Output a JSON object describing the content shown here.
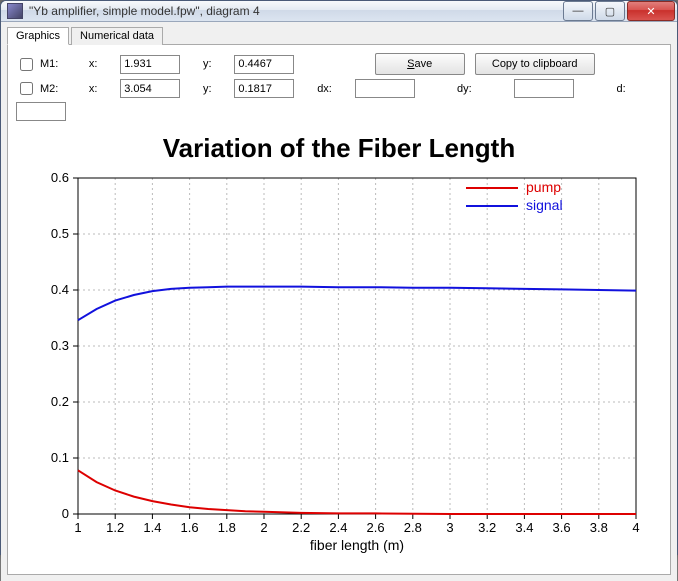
{
  "window": {
    "title": "\"Yb amplifier, simple model.fpw\", diagram 4",
    "controls": {
      "min": "—",
      "max": "▢",
      "close": "✕"
    }
  },
  "tabs": {
    "graphics": "Graphics",
    "numerical": "Numerical data"
  },
  "controls": {
    "m1_label": "M1:",
    "m2_label": "M2:",
    "x_label": "x:",
    "y_label": "y:",
    "dx_label": "dx:",
    "dy_label": "dy:",
    "d_label": "d:",
    "m1": {
      "x": "1.931",
      "y": "0.4467"
    },
    "m2": {
      "x": "3.054",
      "y": "0.1817"
    },
    "dx": "",
    "dy": "",
    "d": "",
    "save": "Save",
    "copy": "Copy to clipboard"
  },
  "chart_data": {
    "type": "line",
    "title": "Variation of the Fiber Length",
    "xlabel": "fiber length (m)",
    "ylabel": "",
    "xlim": [
      1,
      4
    ],
    "ylim": [
      0,
      0.6
    ],
    "xticks": [
      1,
      1.2,
      1.4,
      1.6,
      1.8,
      2,
      2.2,
      2.4,
      2.6,
      2.8,
      3,
      3.2,
      3.4,
      3.6,
      3.8,
      4
    ],
    "yticks": [
      0,
      0.1,
      0.2,
      0.3,
      0.4,
      0.5,
      0.6
    ],
    "legend_position": "top-right",
    "series": [
      {
        "name": "pump",
        "color": "#d00",
        "x": [
          1,
          1.1,
          1.2,
          1.3,
          1.4,
          1.5,
          1.6,
          1.7,
          1.8,
          1.9,
          2,
          2.2,
          2.4,
          2.6,
          3,
          3.5,
          4
        ],
        "y": [
          0.078,
          0.057,
          0.042,
          0.031,
          0.023,
          0.017,
          0.012,
          0.009,
          0.007,
          0.005,
          0.004,
          0.002,
          0.001,
          0.001,
          0.0,
          0.0,
          0.0
        ]
      },
      {
        "name": "signal",
        "color": "#11d",
        "x": [
          1,
          1.1,
          1.2,
          1.3,
          1.4,
          1.5,
          1.6,
          1.7,
          1.8,
          1.9,
          2,
          2.2,
          2.4,
          2.6,
          2.8,
          3,
          3.2,
          3.4,
          3.6,
          3.8,
          4
        ],
        "y": [
          0.346,
          0.366,
          0.381,
          0.391,
          0.398,
          0.402,
          0.404,
          0.405,
          0.406,
          0.406,
          0.406,
          0.406,
          0.405,
          0.405,
          0.404,
          0.404,
          0.403,
          0.402,
          0.401,
          0.4,
          0.399
        ]
      }
    ]
  }
}
